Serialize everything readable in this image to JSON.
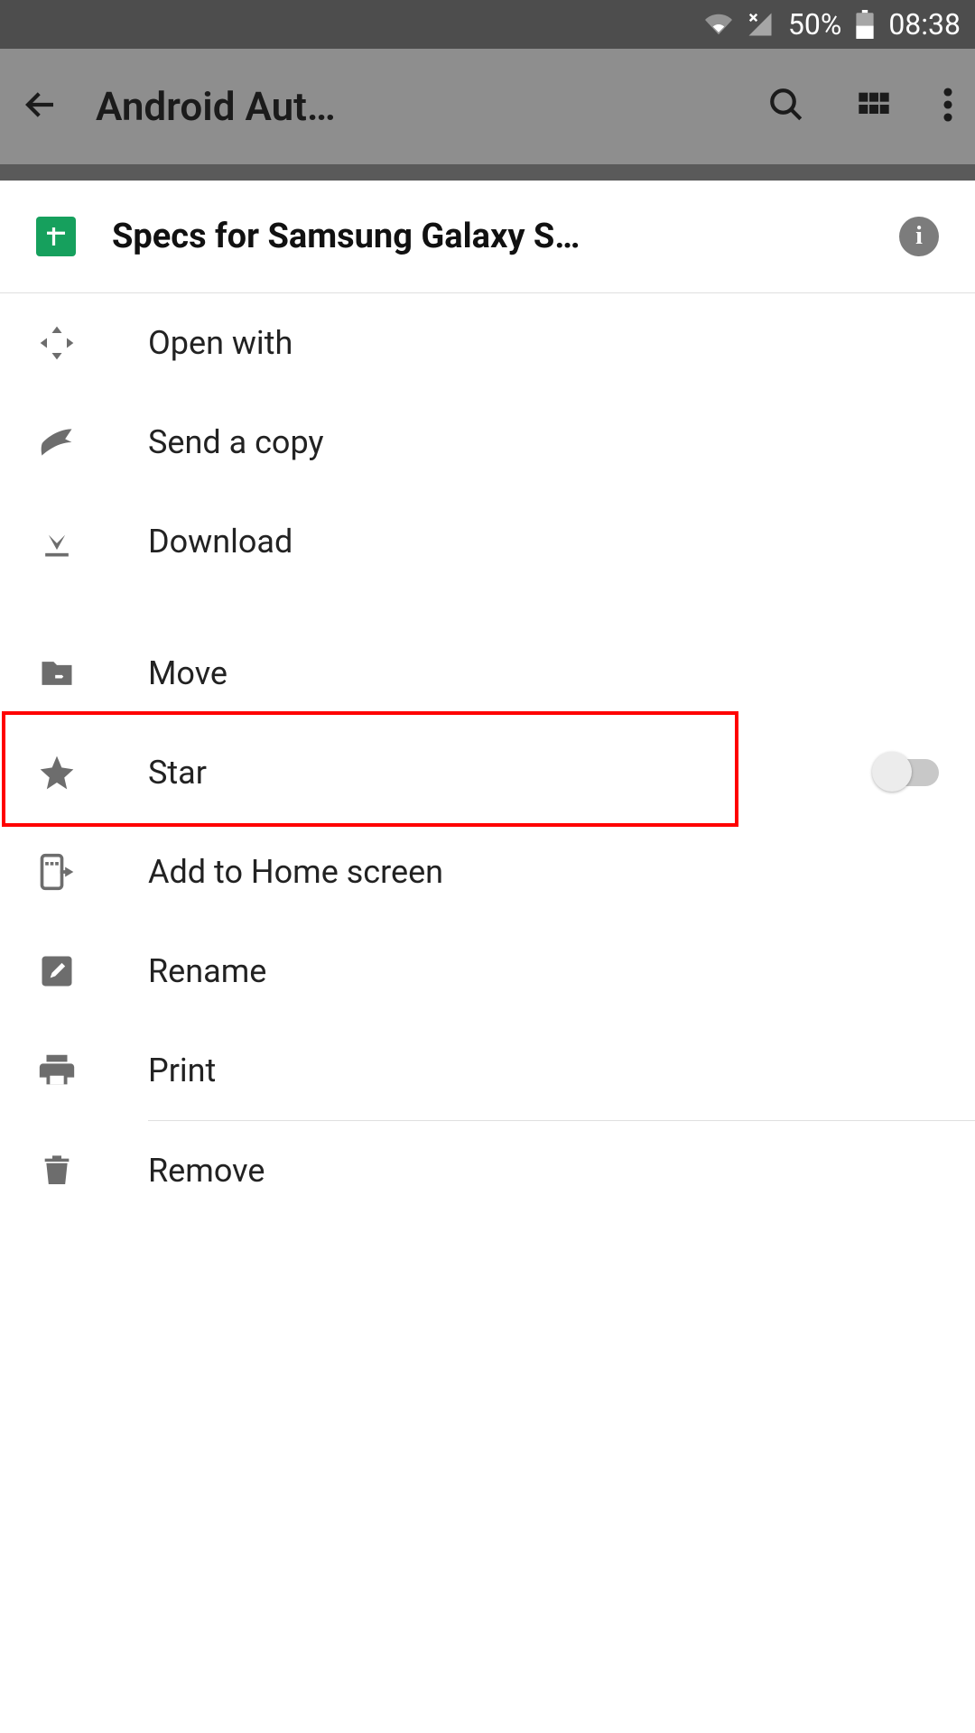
{
  "status": {
    "battery": "50%",
    "time": "08:38"
  },
  "toolbar": {
    "title": "Android Aut…"
  },
  "sheet": {
    "file_title": "Specs for Samsung Galaxy S…"
  },
  "menu": {
    "open_with": "Open with",
    "send_copy": "Send a copy",
    "download": "Download",
    "move": "Move",
    "star": "Star",
    "add_home": "Add to Home screen",
    "rename": "Rename",
    "print": "Print",
    "remove": "Remove"
  }
}
